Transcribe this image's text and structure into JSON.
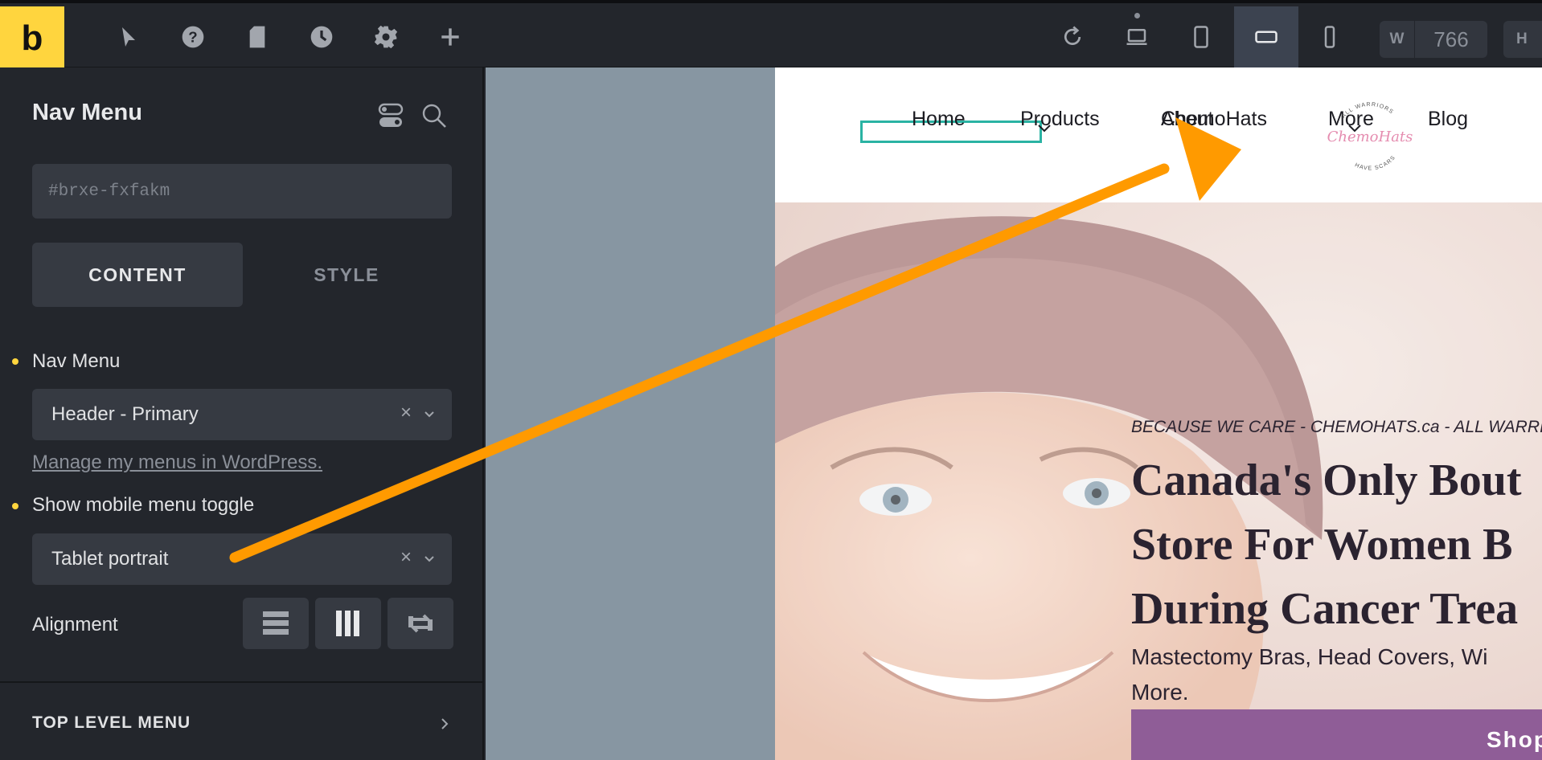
{
  "toolbar": {
    "logo": "b",
    "width_label": "W",
    "width_value": "766",
    "height_label": "H"
  },
  "panel": {
    "title": "Nav Menu",
    "id_placeholder": "#brxe-fxfakm",
    "tabs": [
      {
        "label": "CONTENT"
      },
      {
        "label": "STYLE"
      }
    ],
    "nav_menu_label": "Nav Menu",
    "nav_menu_value": "Header - Primary",
    "manage_link": "Manage my menus in WordPress.",
    "mobile_toggle_label": "Show mobile menu toggle",
    "mobile_toggle_value": "Tablet portrait",
    "clear_glyph": "×",
    "alignment_label": "Alignment",
    "section_label": "TOP LEVEL MENU"
  },
  "site": {
    "nav": [
      "Home",
      "Products",
      "About",
      "ChemoHats",
      "More",
      "Blog"
    ],
    "logo_top": "ALL WARRIORS",
    "logo_script": "ChemoHats",
    "logo_bottom": "HAVE SCARS",
    "hero_tagline": "BECAUSE WE CARE - CHEMOHATS.ca - ALL WARRIO",
    "hero_heading_lines": [
      "Canada's Only Bout",
      "Store For Women B",
      "During Cancer Trea"
    ],
    "hero_sub_lines": [
      "Mastectomy Bras, Head Covers, Wi",
      "More."
    ],
    "shop_button": "Shop"
  },
  "colors": {
    "accent_yellow": "#ffd53e",
    "arrow_orange": "#ff9a00",
    "selection_teal": "#2ab3a3",
    "shop_purple": "#8f5d97"
  }
}
